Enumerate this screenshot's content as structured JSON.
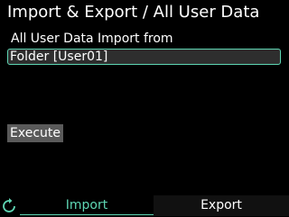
{
  "header": {
    "title": "Import & Export / All User Data"
  },
  "main": {
    "section_label": "All User Data Import from",
    "source_field_value": "Folder [User01]",
    "execute_label": "Execute"
  },
  "footer": {
    "back_icon": "refresh-back-icon",
    "tabs": [
      {
        "label": "Import",
        "active": true
      },
      {
        "label": "Export",
        "active": false
      }
    ]
  },
  "colors": {
    "accent": "#5fd6b4",
    "background": "#000000",
    "field_background": "#2e2e2e",
    "button_background": "#5a5a5a"
  }
}
